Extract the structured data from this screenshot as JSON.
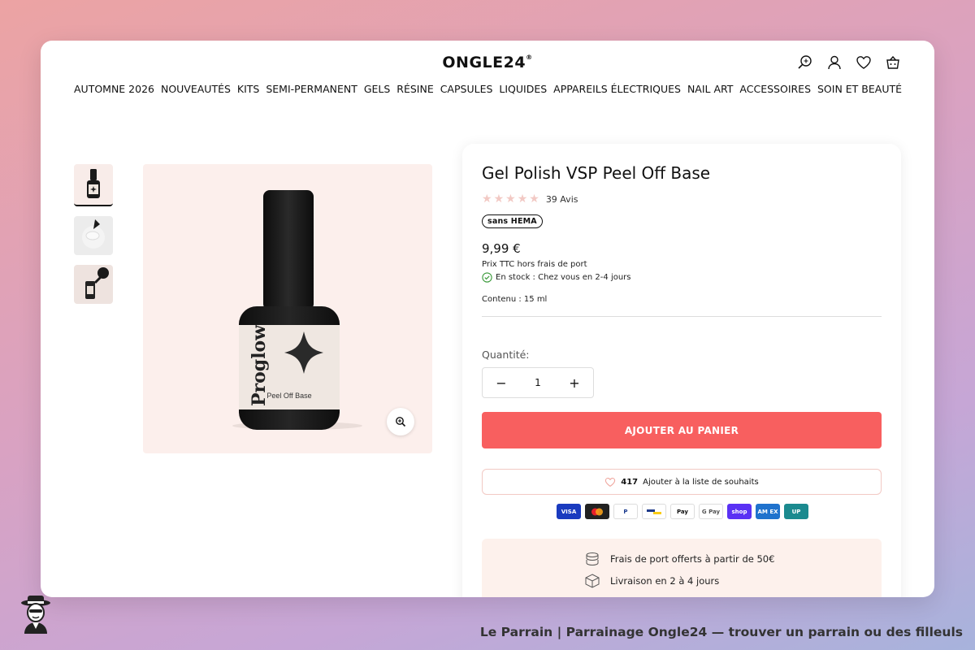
{
  "header": {
    "logo": "ONGLE24",
    "logo_mark": "®",
    "icons": [
      "search-icon",
      "account-icon",
      "heart-icon",
      "cart-icon"
    ]
  },
  "nav": {
    "items": [
      "AUTOMNE 2026",
      "NOUVEAUTÉS",
      "KITS",
      "SEMI-PERMANENT",
      "GELS",
      "RÉSINE",
      "CAPSULES",
      "LIQUIDES",
      "APPAREILS ÉLECTRIQUES",
      "NAIL ART",
      "ACCESSOIRES",
      "SOIN ET BEAUTÉ"
    ]
  },
  "product": {
    "title": "Gel Polish VSP Peel Off Base",
    "rating_count": "39 Avis",
    "rating_stars": 5,
    "badge": "sans HEMA",
    "price": "9,99 €",
    "tax_note": "Prix TTC hors frais de port",
    "stock": "En stock : Chez vous en 2-4 jours",
    "content": "Contenu : 15 ml",
    "quantity_label": "Quantité:",
    "quantity": "1",
    "add_to_cart": "AJOUTER AU PANIER",
    "wishlist_count": "417",
    "wishlist_label": "Ajouter à la liste de souhaits",
    "bottle_brand": "Proglow",
    "bottle_label": "Peel Off Base"
  },
  "payments": [
    "VISA",
    "Mastercard",
    "PayPal",
    "Bancontact",
    "Apple Pay",
    "G Pay",
    "shop",
    "AMEX",
    "UnionPay"
  ],
  "shipping": {
    "free_shipping": "Frais de port offerts à partir de 50€",
    "delivery": "Livraison en 2 à 4 jours"
  },
  "colors": {
    "accent": "#f85f5f",
    "image_bg": "#fcefec",
    "shipping_bg": "#fdf1ec"
  },
  "footer": {
    "caption": "Le Parrain | Parrainage Ongle24 — trouver un parrain ou des filleuls"
  }
}
